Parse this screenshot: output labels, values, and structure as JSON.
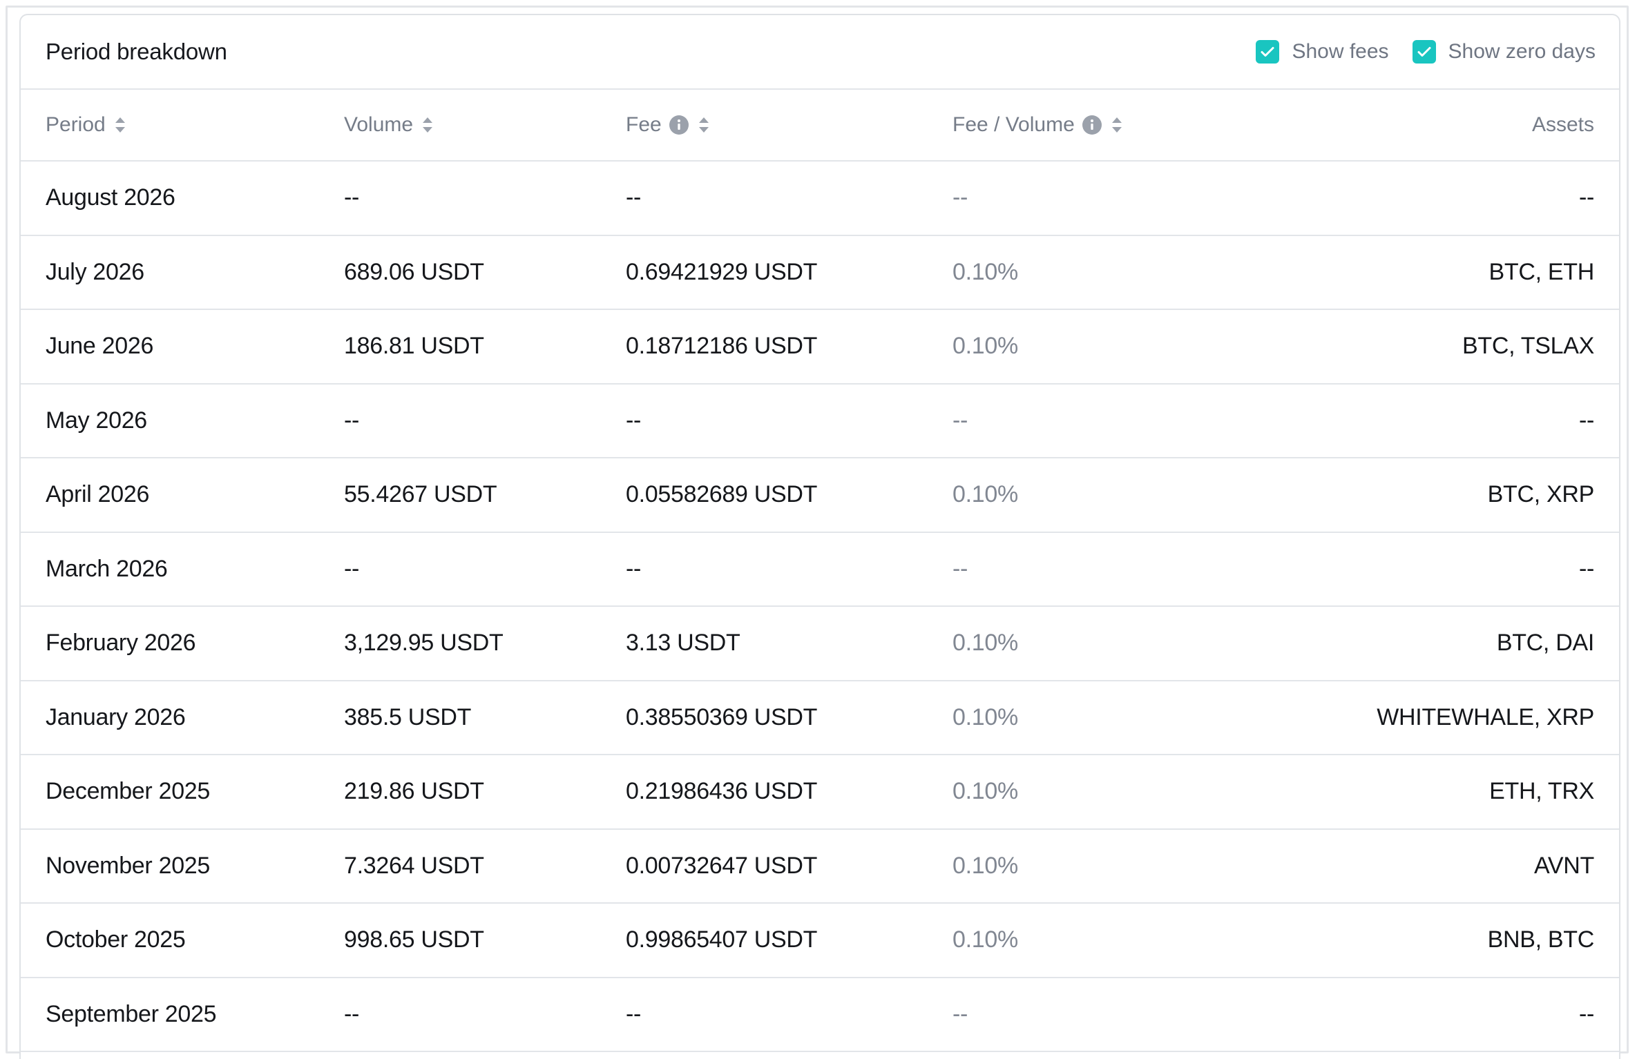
{
  "card": {
    "title": "Period breakdown",
    "toggles": [
      {
        "label": "Show fees",
        "checked": true
      },
      {
        "label": "Show zero days",
        "checked": true
      }
    ]
  },
  "table": {
    "columns": [
      {
        "label": "Period",
        "sortable": true,
        "info": false
      },
      {
        "label": "Volume",
        "sortable": true,
        "info": false
      },
      {
        "label": "Fee",
        "sortable": true,
        "info": true
      },
      {
        "label": "Fee / Volume",
        "sortable": true,
        "info": true
      },
      {
        "label": "Assets",
        "sortable": false,
        "info": false
      }
    ],
    "rows": [
      {
        "period": "August 2026",
        "volume": "--",
        "fee": "--",
        "ratio": "--",
        "assets": "--"
      },
      {
        "period": "July 2026",
        "volume": "689.06 USDT",
        "fee": "0.69421929 USDT",
        "ratio": "0.10%",
        "assets": "BTC, ETH"
      },
      {
        "period": "June 2026",
        "volume": "186.81 USDT",
        "fee": "0.18712186 USDT",
        "ratio": "0.10%",
        "assets": "BTC, TSLAX"
      },
      {
        "period": "May 2026",
        "volume": "--",
        "fee": "--",
        "ratio": "--",
        "assets": "--"
      },
      {
        "period": "April 2026",
        "volume": "55.4267 USDT",
        "fee": "0.05582689 USDT",
        "ratio": "0.10%",
        "assets": "BTC, XRP"
      },
      {
        "period": "March 2026",
        "volume": "--",
        "fee": "--",
        "ratio": "--",
        "assets": "--"
      },
      {
        "period": "February 2026",
        "volume": "3,129.95 USDT",
        "fee": "3.13 USDT",
        "ratio": "0.10%",
        "assets": "BTC, DAI"
      },
      {
        "period": "January 2026",
        "volume": "385.5 USDT",
        "fee": "0.38550369 USDT",
        "ratio": "0.10%",
        "assets": "WHITEWHALE, XRP"
      },
      {
        "period": "December 2025",
        "volume": "219.86 USDT",
        "fee": "0.21986436 USDT",
        "ratio": "0.10%",
        "assets": "ETH, TRX"
      },
      {
        "period": "November 2025",
        "volume": "7.3264 USDT",
        "fee": "0.00732647 USDT",
        "ratio": "0.10%",
        "assets": "AVNT"
      },
      {
        "period": "October 2025",
        "volume": "998.65 USDT",
        "fee": "0.99865407 USDT",
        "ratio": "0.10%",
        "assets": "BNB, BTC"
      },
      {
        "period": "September 2025",
        "volume": "--",
        "fee": "--",
        "ratio": "--",
        "assets": "--"
      }
    ]
  },
  "colors": {
    "accent": "#19c5c0",
    "border": "#e2e5e9",
    "text": "#15171b",
    "muted": "#818792"
  },
  "icons": {
    "checkbox": "check-icon",
    "sort": "sort-icon",
    "info": "info-icon"
  }
}
